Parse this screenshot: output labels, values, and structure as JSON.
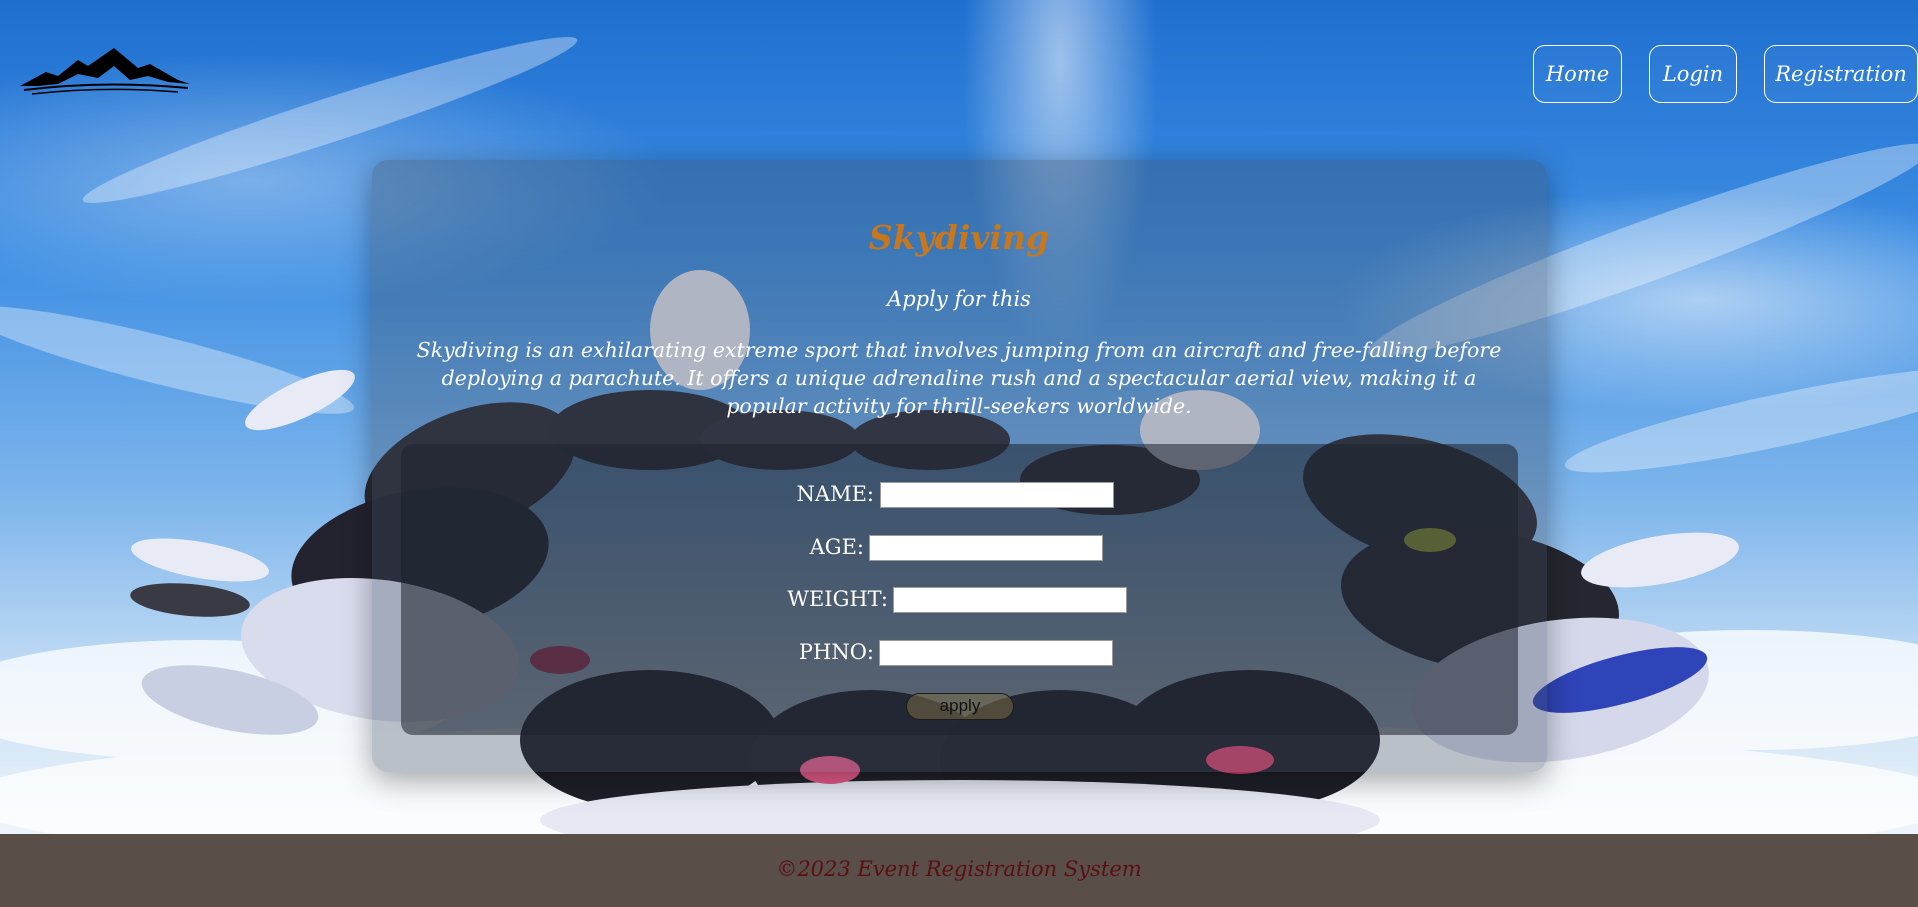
{
  "header": {
    "logo_icon": "mountain-logo",
    "nav": [
      {
        "label": "Home"
      },
      {
        "label": "Login"
      },
      {
        "label": "Registration"
      }
    ]
  },
  "main": {
    "title": "Skydiving",
    "subtitle": "Apply for this",
    "description": "Skydiving is an exhilarating extreme sport that involves jumping from an aircraft and free-falling before deploying a parachute. It offers a unique adrenaline rush and a spectacular aerial view, making it a popular activity for thrill-seekers worldwide."
  },
  "form": {
    "fields": [
      {
        "label": "NAME:",
        "value": ""
      },
      {
        "label": "AGE:",
        "value": ""
      },
      {
        "label": "WEIGHT:",
        "value": ""
      },
      {
        "label": "PHNO:",
        "value": ""
      }
    ],
    "submit_label": "apply"
  },
  "footer": {
    "text": "©2023 Event Registration System"
  },
  "colors": {
    "title": "#c8771a",
    "footer_bg": "#5a4e49",
    "footer_text": "#5a0f12"
  }
}
